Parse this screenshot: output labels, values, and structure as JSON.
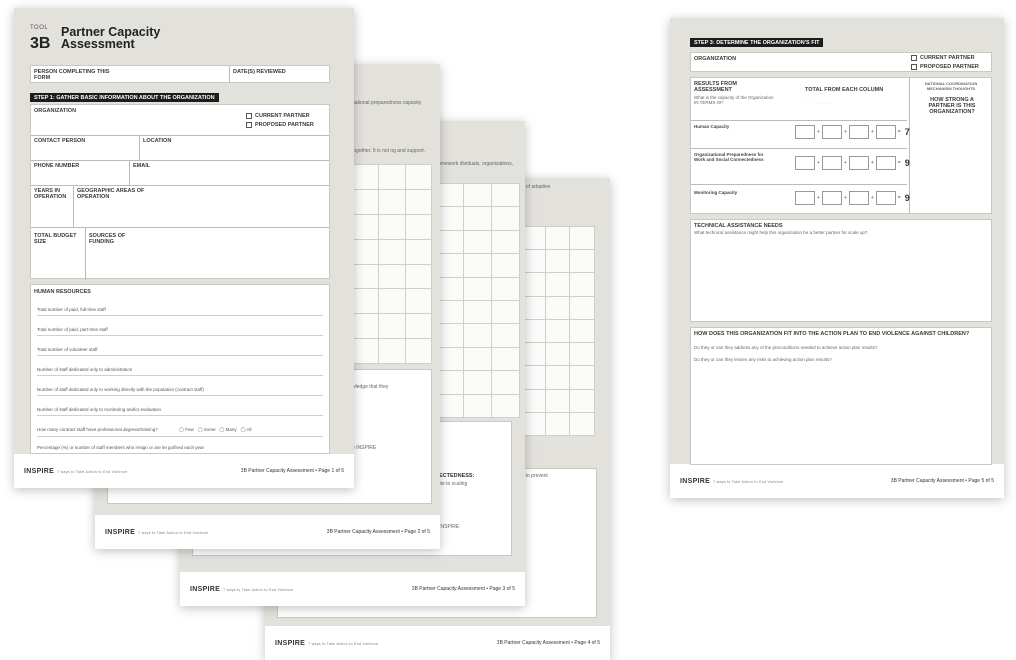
{
  "footer": {
    "brand": "INSPIRE",
    "brand_tagline": "7 ways to Take Action to End Violence",
    "page1": "3B Partner Capacity Assessment  •  Page 1 of 5",
    "page2": "3B Partner Capacity Assessment  •  Page 2 of 5",
    "page3": "3B Partner Capacity Assessment  •  Page 3 of 5",
    "page4": "3B Partner Capacity Assessment  •  Page 4 of 5",
    "page5": "3B Partner Capacity Assessment  •  Page 5 of 5"
  },
  "page1": {
    "tool_label": "TOOL",
    "tool_number": "3B",
    "title": "Partner Capacity Assessment",
    "person_completing": "PERSON COMPLETING THIS FORM",
    "dates_reviewed": "DATE(S) REVIEWED",
    "step1": "STEP 1: GATHER BASIC INFORMATION ABOUT THE ORGANIZATION",
    "organization": "ORGANIZATION",
    "current_partner": "CURRENT PARTNER",
    "proposed_partner": "PROPOSED PARTNER",
    "contact_person": "CONTACT PERSON",
    "location": "LOCATION",
    "phone_number": "PHONE NUMBER",
    "email": "EMAIL",
    "years_in_operation": "YEARS IN OPERATION",
    "geographic_areas": "GEOGRAPHIC AREAS OF OPERATION",
    "total_budget": "TOTAL BUDGET SIZE",
    "sources_of_funding": "SOURCES OF FUNDING",
    "human_resources": "HUMAN RESOURCES",
    "hr_rows": [
      "Total number of paid, full-time staff",
      "Total number of paid, part-time staff",
      "Total number of volunteer staff",
      "Number of staff dedicated only to administration",
      "Number of staff dedicated only to working directly with the population (contract staff)",
      "Number of staff dedicated only to monitoring and/or evaluation"
    ],
    "degree_question": "How many contract staff have professional degrees/training?",
    "degree_options": [
      "Few",
      "Some",
      "Many",
      "All"
    ],
    "turnover_row": "Percentage (%) or number of staff members who resign or are let go/fired each year"
  },
  "page2": {
    "peek_intro": "national preparedness capacity",
    "peek_together": "together. It is not ng and support.",
    "peek_knowledge": "wledge that they",
    "peek_inspire": "e INSPIRE"
  },
  "page3": {
    "peek_framework": "framework dividuals, organizations,",
    "peek_connectedness": "NECTEDNESS:",
    "peek_scaling": "bute to scaling",
    "peek_inspire": "e INSPIRE"
  },
  "page4": {
    "peek_adaptive": "re of adaptive",
    "peek_prevent": "activities to prevent"
  },
  "page5": {
    "step3": "STEP 3: DETERMINE THE ORGANIZATION'S FIT",
    "organization": "ORGANIZATION",
    "current_partner": "CURRENT PARTNER",
    "proposed_partner": "PROPOSED PARTNER",
    "results_title": "RESULTS FROM ASSESSMENT",
    "results_question": "What is the capacity of the Organization IN TERMS OF:",
    "total_header": "TOTAL FROM EACH COLUMN",
    "national_header": "NATIONAL COORDINATION MECHANISM THOUGHTS",
    "how_strong": "HOW STRONG A PARTNER IS THIS ORGANIZATION?",
    "rows": [
      {
        "label": "Human Capacity",
        "total": "7"
      },
      {
        "label": "Organizational Preparedness for Work and Social Connectedness",
        "total": "9"
      },
      {
        "label": "Monitoring Capacity",
        "total": "9"
      }
    ],
    "ta_title": "TECHNICAL ASSISTANCE NEEDS",
    "ta_question": "What technical assistance might help this organization be a better partner for scale up?",
    "fit_title": "HOW DOES THIS ORGANIZATION FIT INTO THE ACTION PLAN TO END VIOLENCE AGAINST CHILDREN?",
    "fit_q1": "Do they or can they address any of the preconditions needed to achieve action plan results?",
    "fit_q2": "Do they or can they lessen any risks to achieving action plan results?"
  }
}
